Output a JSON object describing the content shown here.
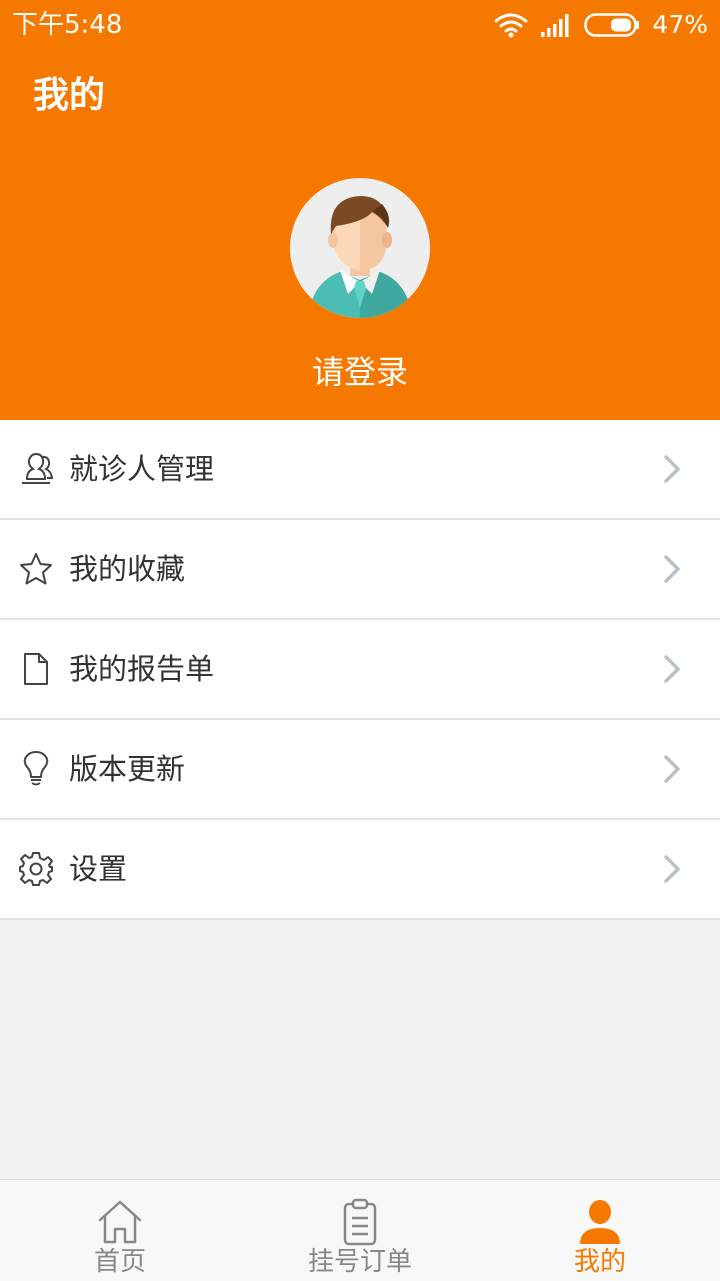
{
  "status_bar": {
    "time": "下午5:48",
    "battery": "47%"
  },
  "header": {
    "title": "我的",
    "login_text": "请登录"
  },
  "menu": {
    "items": [
      {
        "label": "就诊人管理",
        "icon": "patients-icon"
      },
      {
        "label": "我的收藏",
        "icon": "star-icon"
      },
      {
        "label": "我的报告单",
        "icon": "document-icon"
      },
      {
        "label": "版本更新",
        "icon": "lightbulb-icon"
      },
      {
        "label": "设置",
        "icon": "gear-icon"
      }
    ]
  },
  "tabbar": {
    "tabs": [
      {
        "label": "首页",
        "icon": "home-icon",
        "active": false
      },
      {
        "label": "挂号订单",
        "icon": "clipboard-icon",
        "active": false
      },
      {
        "label": "我的",
        "icon": "user-icon",
        "active": true
      }
    ]
  },
  "colors": {
    "accent": "#f57900",
    "menu_text": "#333333",
    "inactive_tab": "#888888",
    "chevron": "#b8c0c8"
  }
}
